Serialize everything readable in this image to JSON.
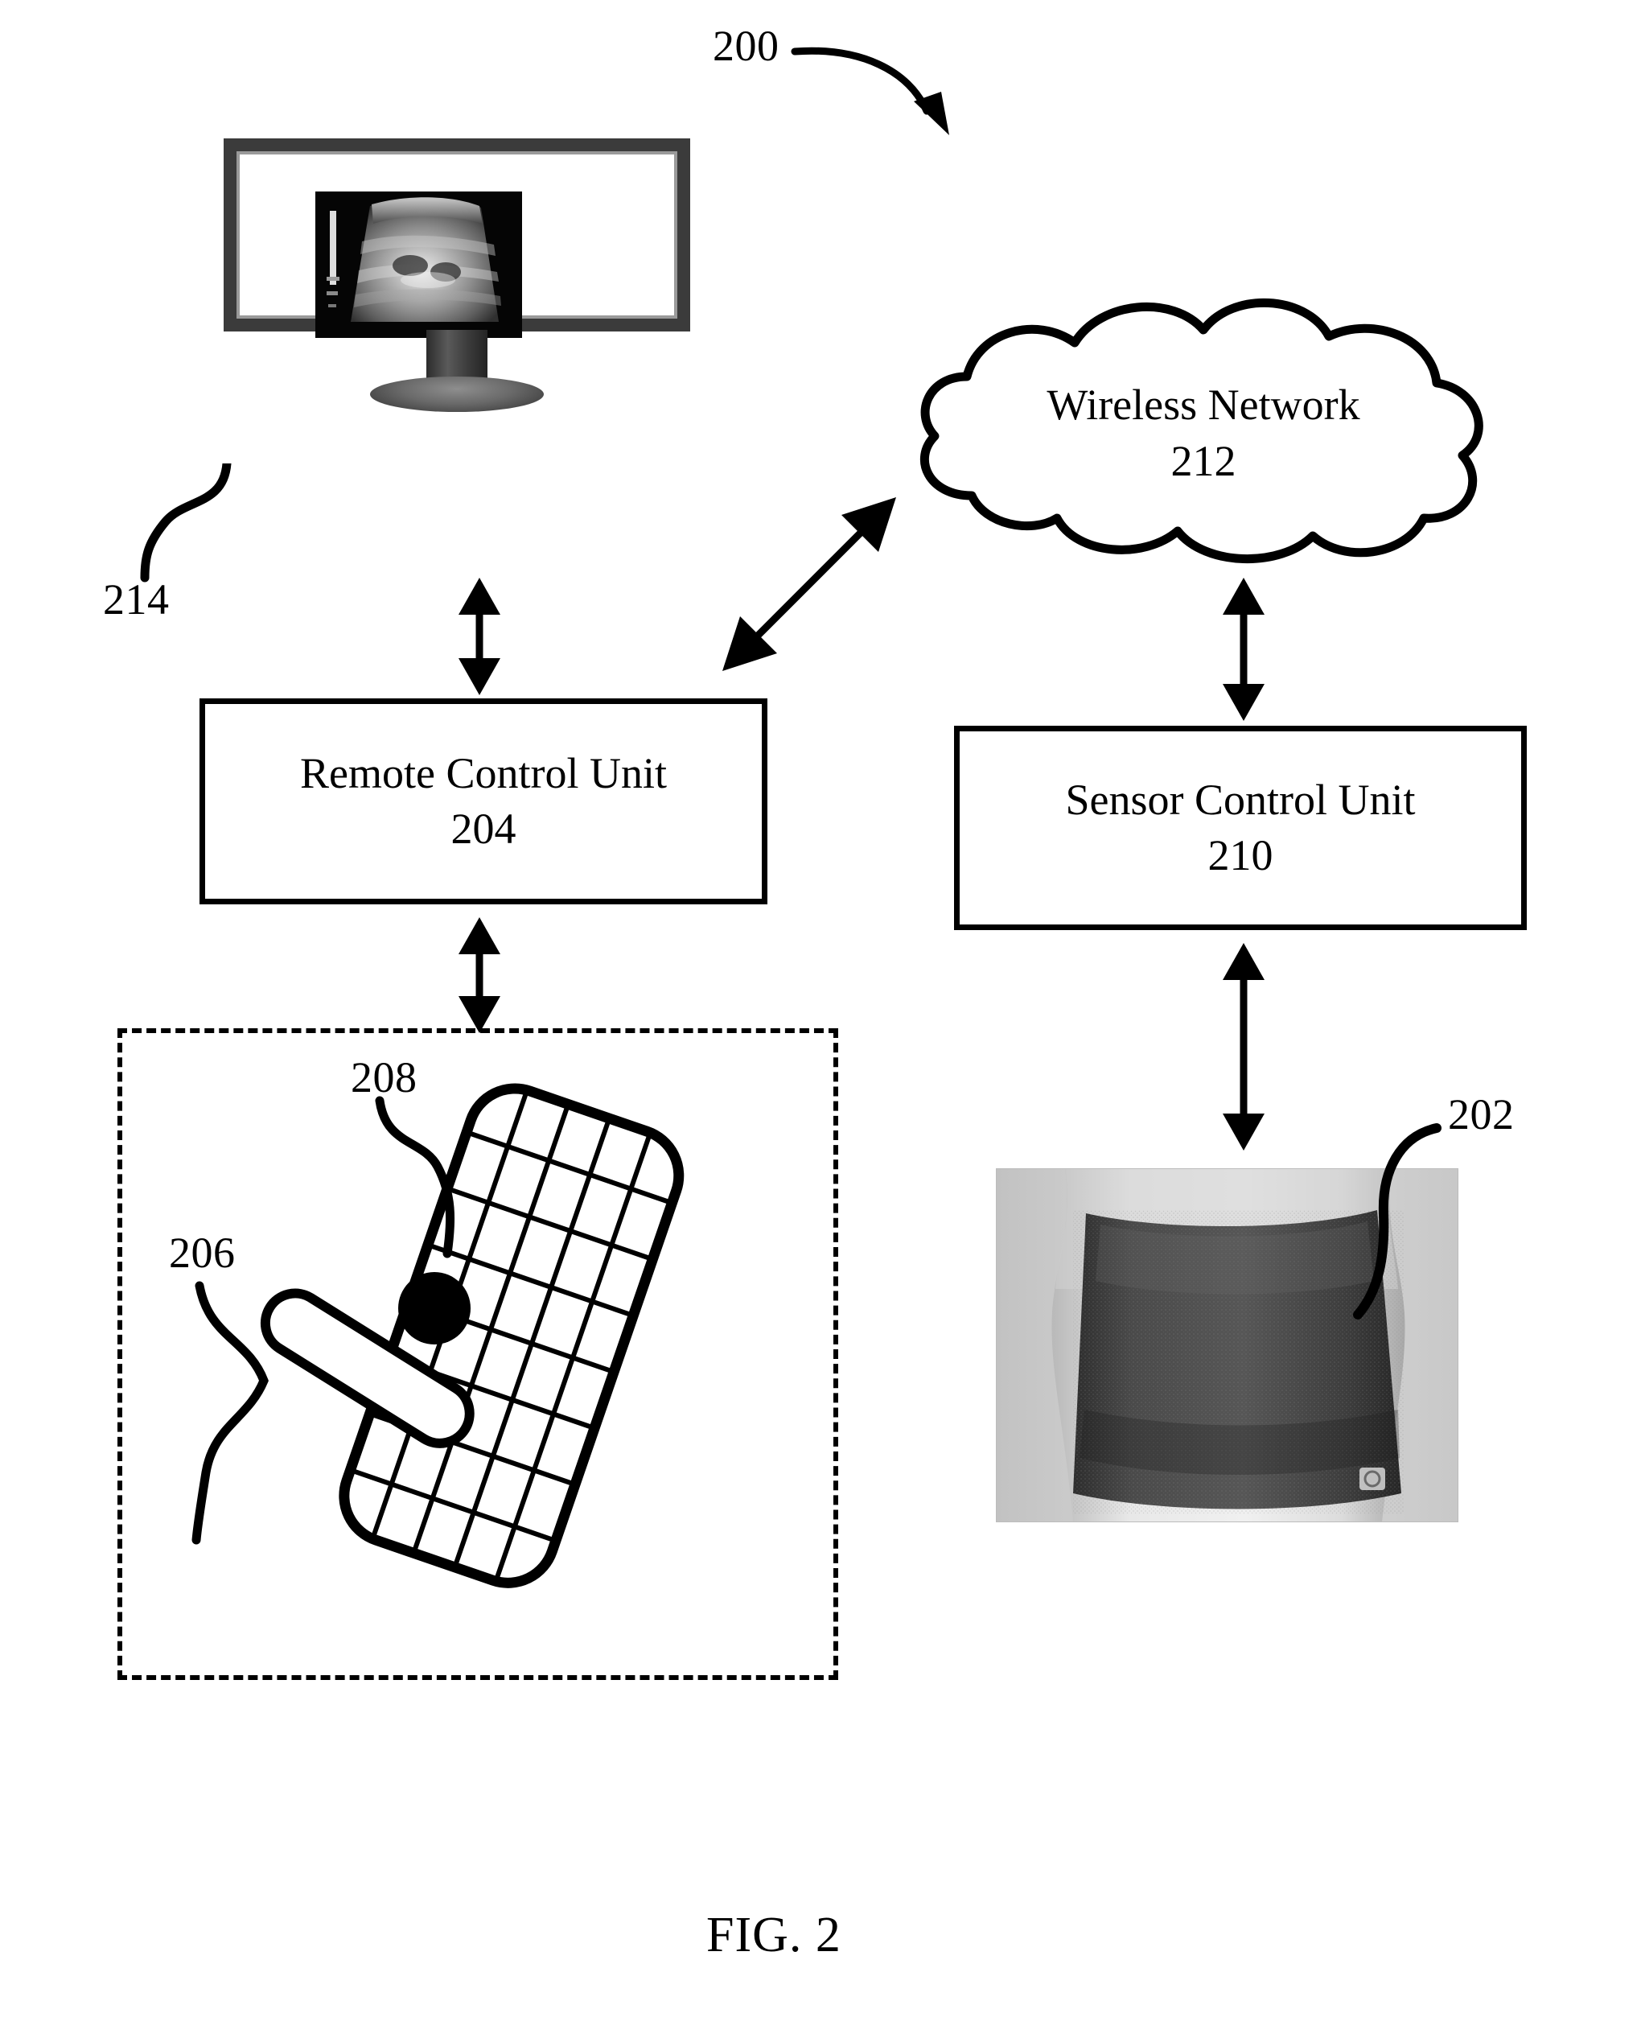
{
  "figure": {
    "caption": "FIG. 2",
    "system_numeral": "200"
  },
  "nodes": {
    "display": {
      "numeral": "214",
      "icon": "monitor-icon",
      "screen_content": "ultrasound-scan-image"
    },
    "wireless_network": {
      "label": "Wireless Network",
      "numeral": "212",
      "icon": "cloud-icon"
    },
    "remote_control_unit": {
      "label": "Remote Control Unit",
      "numeral": "204"
    },
    "sensor_control_unit": {
      "label": "Sensor Control Unit",
      "numeral": "210"
    },
    "sensor_belt": {
      "numeral": "202",
      "icon": "torso-belt-photo"
    },
    "grid_pad": {
      "numeral": "208",
      "icon": "grid-tablet-icon"
    },
    "probe": {
      "numeral": "206",
      "icon": "stylus-probe-icon"
    }
  },
  "connections": [
    {
      "name": "display-to-rcu",
      "kind": "double-arrow",
      "orientation": "vertical"
    },
    {
      "name": "rcu-to-network",
      "kind": "double-arrow",
      "orientation": "diagonal"
    },
    {
      "name": "network-to-scu",
      "kind": "double-arrow",
      "orientation": "vertical"
    },
    {
      "name": "rcu-to-gridpad",
      "kind": "double-arrow",
      "orientation": "vertical"
    },
    {
      "name": "scu-to-belt",
      "kind": "double-arrow",
      "orientation": "vertical"
    }
  ],
  "colors": {
    "ink": "#000000",
    "page": "#ffffff",
    "bezel": "#3b3b3b",
    "screen": "#050505"
  }
}
